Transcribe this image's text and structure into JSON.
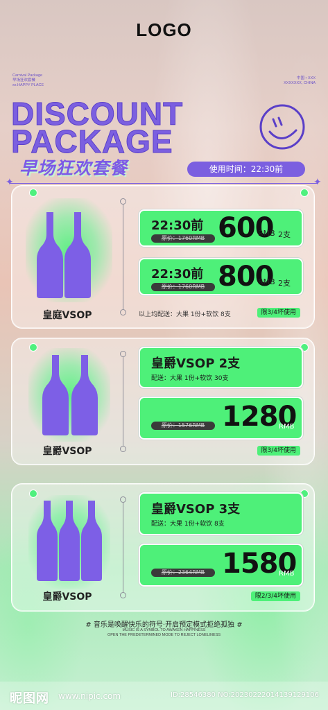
{
  "logo": "LOGO",
  "header_small_left": [
    "Carnival Package",
    "早场狂欢套餐",
    "xx.HAPPY PLACE"
  ],
  "header_small_right": [
    "中国 • XXX",
    "XXXXXXX, CHINA"
  ],
  "headline": [
    "DISCOUNT",
    "PACKAGE"
  ],
  "title_cn": "早场狂欢套餐",
  "time_label": "使用时间：22:30前",
  "colors": {
    "accent": "#7b5fe0",
    "green": "#4ef079"
  },
  "packages": [
    {
      "product": "皇庭VSOP",
      "offers": [
        {
          "time": "22:30前",
          "original": "原价：1760RMB",
          "price": "600",
          "unit": "RMB",
          "qty": "2支"
        },
        {
          "time": "22:30前",
          "original": "原价：1760RMB",
          "price": "800",
          "unit": "RMB",
          "qty": "2支"
        }
      ],
      "note": "以上均配送：大果 1份+软饮 8支",
      "tag": "限3/4坏使用"
    },
    {
      "product": "皇爵VSOP",
      "name": "皇爵VSOP 2支",
      "delivery": "配送：大果 1份+软饮 30支",
      "original": "原价：1576RMB",
      "price": "1280",
      "unit": "RMB",
      "tag": "限3/4坏使用"
    },
    {
      "product": "皇爵VSOP",
      "name": "皇爵VSOP 3支",
      "delivery": "配送：大果 1份+软饮 8支",
      "original": "原价：2364RMB",
      "price": "1580",
      "unit": "RMB",
      "tag": "限2/3/4坏使用"
    }
  ],
  "slogan": "# 音乐是唤醒快乐的符号·开启预定模式拒绝孤独 #",
  "slogan_en": [
    "MUSIC IS A SYMBOL TO AWAKEN HAPPINESS",
    "OPEN THE PREDETERMINED MODE TO REJECT LONELINESS"
  ],
  "watermark": {
    "site": "昵图网",
    "url": "www.nipic.com",
    "id": "ID:28546380 NO:20230222014139129106"
  }
}
